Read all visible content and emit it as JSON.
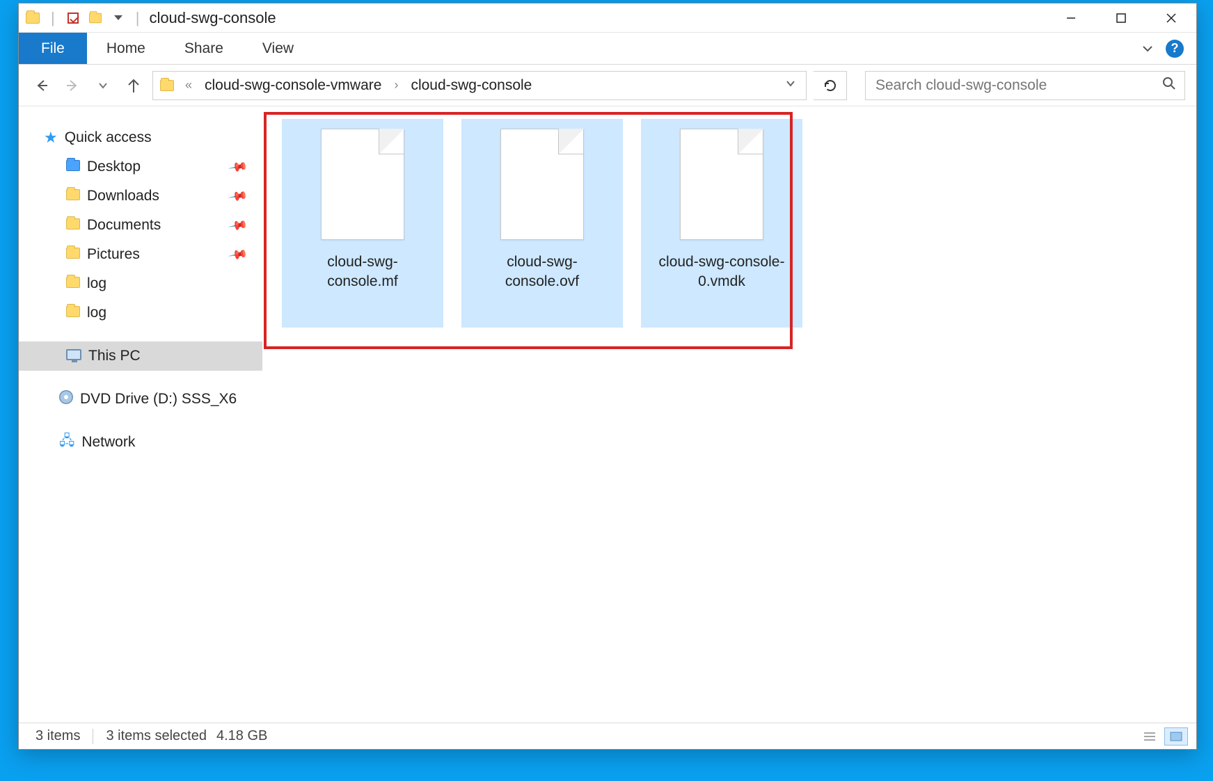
{
  "titlebar": {
    "title": "cloud-swg-console"
  },
  "ribbon": {
    "file": "File",
    "home": "Home",
    "share": "Share",
    "view": "View"
  },
  "address": {
    "prefix": "«",
    "crumbs": [
      "cloud-swg-console-vmware",
      "cloud-swg-console"
    ]
  },
  "search": {
    "placeholder": "Search cloud-swg-console"
  },
  "sidebar": {
    "quick_access": "Quick access",
    "items": [
      {
        "label": "Desktop",
        "pinned": true,
        "icon": "folder-blue"
      },
      {
        "label": "Downloads",
        "pinned": true,
        "icon": "folder"
      },
      {
        "label": "Documents",
        "pinned": true,
        "icon": "folder"
      },
      {
        "label": "Pictures",
        "pinned": true,
        "icon": "folder"
      },
      {
        "label": "log",
        "pinned": false,
        "icon": "folder"
      },
      {
        "label": "log",
        "pinned": false,
        "icon": "folder"
      }
    ],
    "this_pc": "This PC",
    "dvd": "DVD Drive (D:) SSS_X6",
    "network": "Network"
  },
  "files": [
    {
      "name": "cloud-swg-console.mf"
    },
    {
      "name": "cloud-swg-console.ovf"
    },
    {
      "name": "cloud-swg-console-0.vmdk"
    }
  ],
  "status": {
    "count": "3 items",
    "selection": "3 items selected",
    "size": "4.18 GB"
  }
}
